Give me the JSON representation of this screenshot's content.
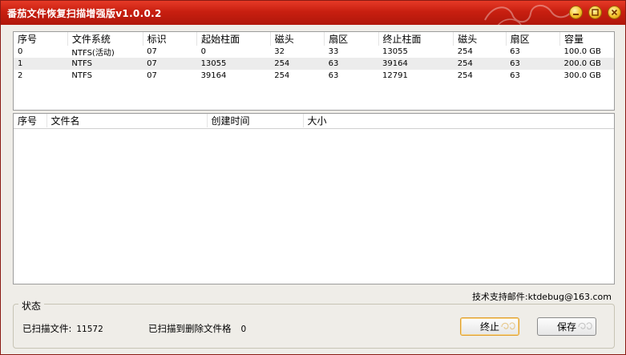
{
  "window": {
    "title": "番茄文件恢复扫描增强版v1.0.0.2"
  },
  "partition_table": {
    "columns": [
      "序号",
      "文件系统",
      "标识",
      "起始柱面",
      "磁头",
      "扇区",
      "终止柱面",
      "磁头",
      "扇区",
      "容量"
    ],
    "rows": [
      [
        "0",
        "NTFS(活动)",
        "07",
        "0",
        "32",
        "33",
        "13055",
        "254",
        "63",
        "100.0 GB"
      ],
      [
        "1",
        "NTFS",
        "07",
        "13055",
        "254",
        "63",
        "39164",
        "254",
        "63",
        "200.0 GB"
      ],
      [
        "2",
        "NTFS",
        "07",
        "39164",
        "254",
        "63",
        "12791",
        "254",
        "63",
        "300.0 GB"
      ]
    ]
  },
  "file_table": {
    "columns": [
      "序号",
      "文件名",
      "创建时间",
      "大小"
    ]
  },
  "support_text": "技术支持邮件:ktdebug@163.com",
  "status": {
    "legend": "状态",
    "scanned_label": "已扫描文件:",
    "scanned_value": "11572",
    "deleted_label": "已扫描到删除文件格",
    "deleted_value": "0"
  },
  "buttons": {
    "stop": "终止",
    "save": "保存"
  },
  "colors": {
    "titlebar": "#c81f10",
    "window_bg": "#efede8",
    "focus_border": "#e0a030"
  }
}
